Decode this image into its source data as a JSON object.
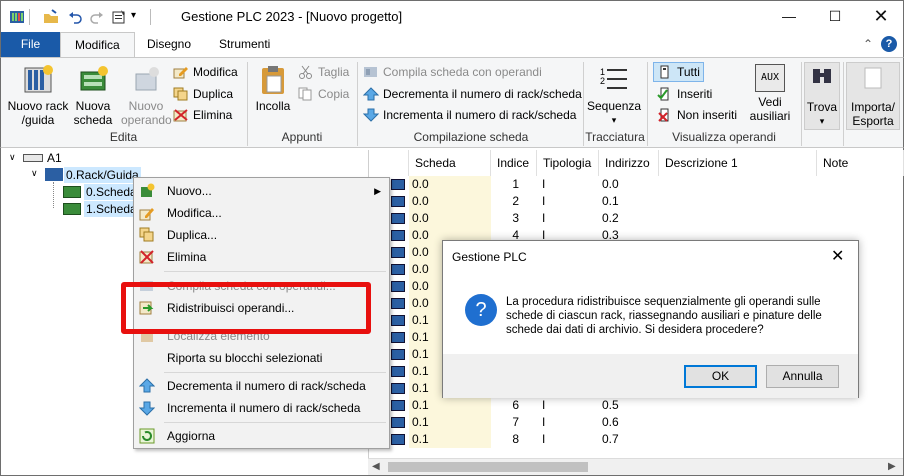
{
  "window": {
    "title": "Gestione PLC 2023 - [Nuovo progetto]"
  },
  "menubar": {
    "tabs": [
      "File",
      "Modifica",
      "Disegno",
      "Strumenti"
    ]
  },
  "ribbon": {
    "edita": {
      "label": "Edita",
      "new_rack": "Nuovo rack\n/guida",
      "new_card": "Nuova\nscheda",
      "new_operand": "Nuovo\noperando",
      "modifica": "Modifica",
      "duplica": "Duplica",
      "elimina": "Elimina"
    },
    "appunti": {
      "label": "Appunti",
      "incolla": "Incolla",
      "taglia": "Taglia",
      "copia": "Copia"
    },
    "compilazione": {
      "label": "Compilazione scheda",
      "compila": "Compila scheda con operandi",
      "decrementa": "Decrementa il numero di rack/scheda",
      "incrementa": "Incrementa il numero di rack/scheda"
    },
    "tracciatura": {
      "label": "Tracciatura",
      "sequenza": "Sequenza"
    },
    "visualizza": {
      "label": "Visualizza operandi",
      "tutti": "Tutti",
      "inseriti": "Inseriti",
      "non_inseriti": "Non inseriti",
      "vedi_ausiliari": "Vedi\nausiliari",
      "aux": "AUX"
    },
    "trova": "Trova",
    "importa": "Importa/\nEsporta"
  },
  "tree": {
    "root": "A1",
    "rack": "0.Rack/Guida",
    "cards": [
      "0.Scheda",
      "1.Scheda"
    ]
  },
  "grid": {
    "headers": [
      "Scheda",
      "Indice",
      "Tipologia",
      "Indirizzo",
      "Descrizione 1",
      "Note"
    ],
    "rows": [
      {
        "scheda": "0.0",
        "indice": "1",
        "tipo": "I",
        "indirizzo": "0.0"
      },
      {
        "scheda": "0.0",
        "indice": "2",
        "tipo": "I",
        "indirizzo": "0.1"
      },
      {
        "scheda": "0.0",
        "indice": "3",
        "tipo": "I",
        "indirizzo": "0.2"
      },
      {
        "scheda": "0.0",
        "indice": "4",
        "tipo": "I",
        "indirizzo": "0.3"
      },
      {
        "scheda": "0.0",
        "indice": "",
        "tipo": "",
        "indirizzo": ""
      },
      {
        "scheda": "0.0",
        "indice": "",
        "tipo": "",
        "indirizzo": ""
      },
      {
        "scheda": "0.0",
        "indice": "",
        "tipo": "",
        "indirizzo": ""
      },
      {
        "scheda": "0.0",
        "indice": "",
        "tipo": "",
        "indirizzo": ""
      },
      {
        "scheda": "0.1",
        "indice": "",
        "tipo": "",
        "indirizzo": ""
      },
      {
        "scheda": "0.1",
        "indice": "",
        "tipo": "",
        "indirizzo": ""
      },
      {
        "scheda": "0.1",
        "indice": "",
        "tipo": "",
        "indirizzo": ""
      },
      {
        "scheda": "0.1",
        "indice": "",
        "tipo": "",
        "indirizzo": ""
      },
      {
        "scheda": "0.1",
        "indice": "",
        "tipo": "",
        "indirizzo": ""
      },
      {
        "scheda": "0.1",
        "indice": "6",
        "tipo": "I",
        "indirizzo": "0.5"
      },
      {
        "scheda": "0.1",
        "indice": "7",
        "tipo": "I",
        "indirizzo": "0.6"
      },
      {
        "scheda": "0.1",
        "indice": "8",
        "tipo": "I",
        "indirizzo": "0.7"
      }
    ]
  },
  "context_menu": {
    "items": [
      "Nuovo...",
      "Modifica...",
      "Duplica...",
      "Elimina",
      "Compila scheda con operandi...",
      "Ridistribuisci operandi...",
      "Localizza elemento",
      "Riporta su blocchi selezionati",
      "Decrementa il numero di rack/scheda",
      "Incrementa il numero di rack/scheda",
      "Aggiorna"
    ]
  },
  "dialog": {
    "title": "Gestione PLC",
    "message": "La procedura ridistribuisce sequenzialmente gli operandi sulle schede di ciascun rack, riassegnando ausiliari e pinature delle schede dai dati di archivio. Si desidera procedere?",
    "ok": "OK",
    "cancel": "Annulla"
  },
  "colors": {
    "accent": "#1a5aa8",
    "highlight": "#e8100e",
    "selection": "#cce8ff"
  }
}
